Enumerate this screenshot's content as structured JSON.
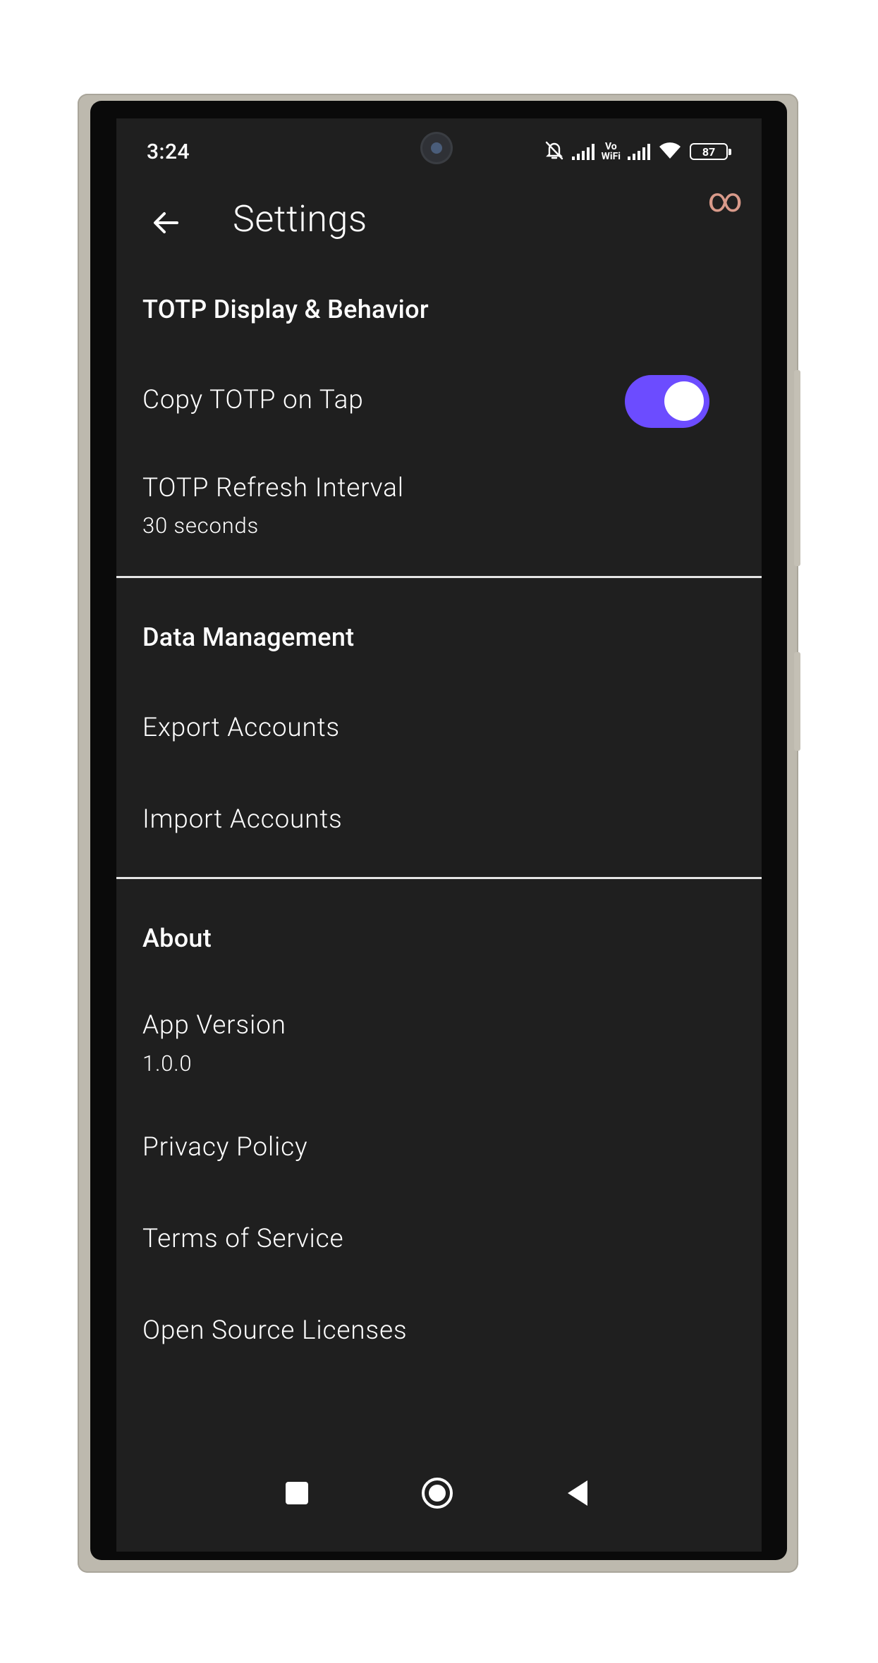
{
  "status_bar": {
    "time": "3:24",
    "battery": "87",
    "vowifi_top": "Vo",
    "vowifi_bottom": "WiFi",
    "icons": [
      "mute-icon",
      "signal-icon",
      "vowifi-icon",
      "signal-icon",
      "wifi-icon",
      "battery-icon"
    ]
  },
  "overlay_badge": "∞",
  "app_bar": {
    "back_icon": "arrow-left-icon",
    "title": "Settings"
  },
  "sections": {
    "totp": {
      "header": "TOTP Display & Behavior",
      "copy_on_tap": {
        "label": "Copy TOTP on Tap",
        "enabled": true
      },
      "refresh_interval": {
        "label": "TOTP Refresh Interval",
        "value": "30 seconds"
      }
    },
    "data": {
      "header": "Data Management",
      "export": "Export Accounts",
      "import": "Import Accounts"
    },
    "about": {
      "header": "About",
      "version_label": "App Version",
      "version_value": "1.0.0",
      "privacy": "Privacy Policy",
      "terms": "Terms of Service",
      "licenses": "Open Source Licenses"
    }
  },
  "nav_bar": {
    "icons": [
      "recents-square-icon",
      "home-circle-icon",
      "back-triangle-icon"
    ]
  },
  "colors": {
    "background": "#1f1f1f",
    "accent": "#6c4cff",
    "text": "#ffffff",
    "divider": "#e6e6e6"
  }
}
